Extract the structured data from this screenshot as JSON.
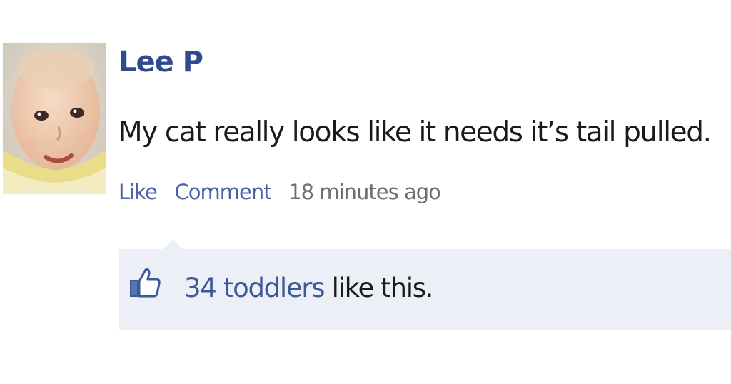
{
  "post": {
    "author": "Lee P",
    "message": "My cat really looks like it needs it’s tail pulled.",
    "actions": {
      "like_label": "Like",
      "comment_label": "Comment",
      "timestamp": "18 minutes ago"
    },
    "likes": {
      "count_text": "34 toddlers",
      "suffix_text": "like this."
    }
  },
  "icons": {
    "avatar": "baby-photo",
    "like": "thumbs-up-icon"
  },
  "colors": {
    "author_link": "#2f4a8f",
    "action_link": "#4a63a8",
    "timestamp": "#6f6f6f",
    "like_box_bg": "#eceff5",
    "likes_link": "#3b5998"
  }
}
